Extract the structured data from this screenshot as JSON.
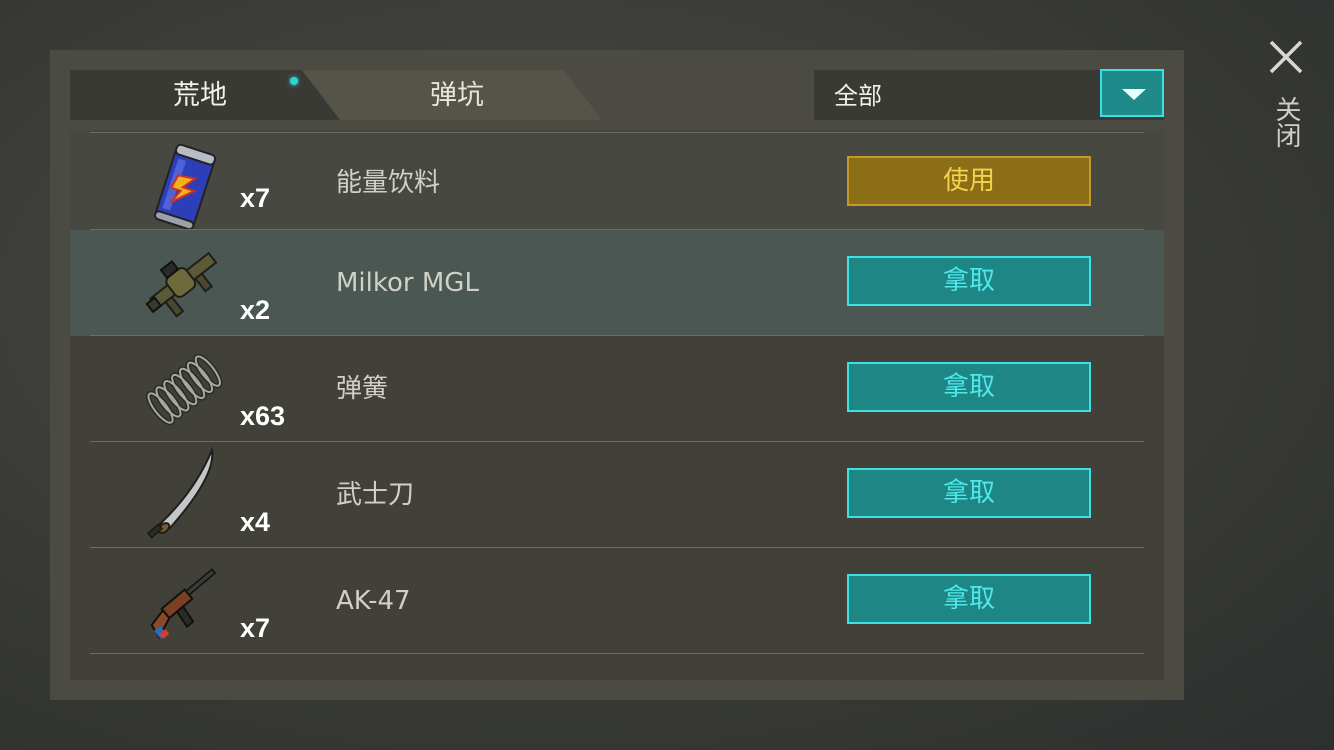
{
  "tabs": [
    {
      "label": "荒地",
      "active": true,
      "has_notification": true
    },
    {
      "label": "弹坑",
      "active": false
    }
  ],
  "filter": {
    "selected": "全部",
    "dropdown_icon": "triangle-down-icon"
  },
  "close": {
    "label": "关闭",
    "icon": "close-icon"
  },
  "items": [
    {
      "name": "能量饮料",
      "count": "x7",
      "action": "使用",
      "action_type": "use",
      "icon": "energy-drink-icon"
    },
    {
      "name": "Milkor MGL",
      "count": "x2",
      "action": "拿取",
      "action_type": "take",
      "icon": "grenade-launcher-icon",
      "selected": true
    },
    {
      "name": "弹簧",
      "count": "x63",
      "action": "拿取",
      "action_type": "take",
      "icon": "spring-icon"
    },
    {
      "name": "武士刀",
      "count": "x4",
      "action": "拿取",
      "action_type": "take",
      "icon": "katana-icon"
    },
    {
      "name": "AK-47",
      "count": "x7",
      "action": "拿取",
      "action_type": "take",
      "icon": "rifle-icon"
    }
  ],
  "colors": {
    "accent_teal": "#3fe0e2",
    "use_gold": "#f3d34a",
    "panel_bg": "#4b4b44"
  }
}
